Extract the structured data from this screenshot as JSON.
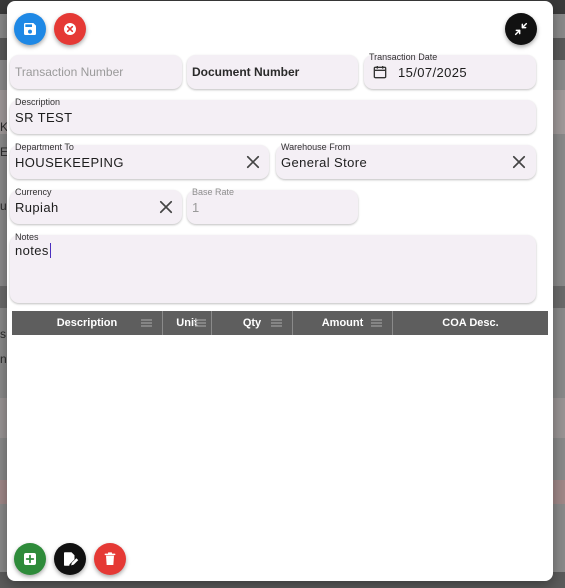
{
  "backdrop": {
    "peek_letters": [
      "K",
      "E",
      "u",
      "s",
      "n"
    ]
  },
  "toolbar": {
    "save_icon": "floppy-disk-icon",
    "cancel_icon": "close-circle-icon",
    "minimize_icon": "collapse-arrows-icon",
    "colors": {
      "save": "#1e88e5",
      "cancel": "#e53935",
      "minimize": "#111111"
    }
  },
  "form": {
    "transaction_number": {
      "placeholder": "Transaction Number",
      "value": ""
    },
    "document_number": {
      "placeholder": "Document Number",
      "value": ""
    },
    "transaction_date": {
      "label": "Transaction Date",
      "value": "15/07/2025",
      "icon": "calendar-icon"
    },
    "description": {
      "label": "Description",
      "value": "SR TEST"
    },
    "department_to": {
      "label": "Department To",
      "value": "HOUSEKEEPING"
    },
    "warehouse_from": {
      "label": "Warehouse From",
      "value": "General Store"
    },
    "currency": {
      "label": "Currency",
      "value": "Rupiah"
    },
    "base_rate": {
      "label": "Base Rate",
      "value": "1"
    },
    "notes": {
      "label": "Notes",
      "value": "notes"
    }
  },
  "grid": {
    "columns": [
      {
        "label": "Description",
        "menu": true
      },
      {
        "label": "Unit",
        "menu": true
      },
      {
        "label": "Qty",
        "menu": true
      },
      {
        "label": "Amount",
        "menu": true
      },
      {
        "label": "COA Desc.",
        "menu": false
      }
    ],
    "header_color": "#5e5e5e"
  },
  "footer": {
    "add_icon": "add-row-icon",
    "edit_icon": "edit-document-icon",
    "delete_icon": "trash-icon",
    "colors": {
      "add": "#2e8b3a",
      "edit": "#111111",
      "delete": "#e53935"
    }
  }
}
